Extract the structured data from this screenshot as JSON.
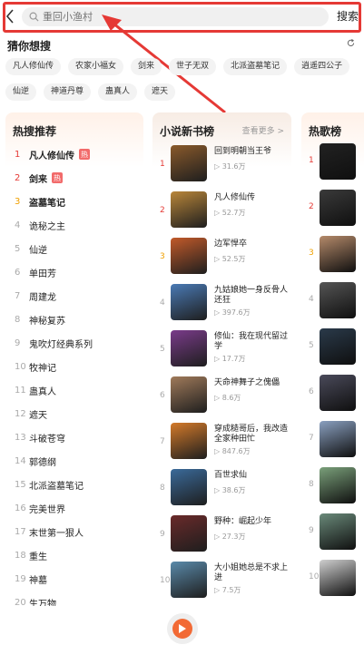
{
  "header": {
    "search_placeholder": "重回小渔村",
    "search_button": "搜索"
  },
  "guess": {
    "title": "猜你想搜",
    "chips": [
      [
        "凡人修仙传",
        "农家小福女",
        "剑来",
        "世子无双",
        "北派盗墓笔记",
        "逍遥四公子"
      ],
      [
        "仙逆",
        "神道丹尊",
        "蛊真人",
        "遮天"
      ]
    ]
  },
  "hot_search": {
    "title": "热搜推荐",
    "hot_badge": "热",
    "items": [
      {
        "rank": "1",
        "name": "凡人修仙传"
      },
      {
        "rank": "2",
        "name": "剑来"
      },
      {
        "rank": "3",
        "name": "盗墓笔记"
      },
      {
        "rank": "4",
        "name": "诡秘之主"
      },
      {
        "rank": "5",
        "name": "仙逆"
      },
      {
        "rank": "6",
        "name": "单田芳"
      },
      {
        "rank": "7",
        "name": "周建龙"
      },
      {
        "rank": "8",
        "name": "神秘复苏"
      },
      {
        "rank": "9",
        "name": "鬼吹灯经典系列"
      },
      {
        "rank": "10",
        "name": "牧神记"
      },
      {
        "rank": "11",
        "name": "蛊真人"
      },
      {
        "rank": "12",
        "name": "遮天"
      },
      {
        "rank": "13",
        "name": "斗破苍穹"
      },
      {
        "rank": "14",
        "name": "郭德纲"
      },
      {
        "rank": "15",
        "name": "北派盗墓笔记"
      },
      {
        "rank": "16",
        "name": "完美世界"
      },
      {
        "rank": "17",
        "name": "末世第一狠人"
      },
      {
        "rank": "18",
        "name": "重生"
      },
      {
        "rank": "19",
        "name": "神墓"
      },
      {
        "rank": "20",
        "name": "生万物"
      }
    ]
  },
  "new_books": {
    "title": "小说新书榜",
    "see_more": "查看更多 >",
    "items": [
      {
        "rank": "1",
        "title": "回到明朝当王爷",
        "count": "31.6万",
        "color": "#8a5a2b"
      },
      {
        "rank": "2",
        "title": "凡人修仙传",
        "count": "52.7万",
        "color": "#b9863a"
      },
      {
        "rank": "3",
        "title": "边军悍卒",
        "count": "52.5万",
        "color": "#c25a2a"
      },
      {
        "rank": "4",
        "title": "九姑娘她一身反骨人还狂",
        "count": "397.6万",
        "color": "#4a7ab5"
      },
      {
        "rank": "5",
        "title": "修仙：我在现代留过学",
        "count": "17.7万",
        "color": "#7a3b8a"
      },
      {
        "rank": "6",
        "title": "天命神舞子之傀儡",
        "count": "8.6万",
        "color": "#a07a5a"
      },
      {
        "rank": "7",
        "title": "穿成糙哥后，我改造全家种田忙",
        "count": "847.6万",
        "color": "#d47a2a"
      },
      {
        "rank": "8",
        "title": "百世求仙",
        "count": "38.6万",
        "color": "#3a6a9a"
      },
      {
        "rank": "9",
        "title": "野种：崛起少年",
        "count": "27.3万",
        "color": "#6a2a2a"
      },
      {
        "rank": "10",
        "title": "大小姐她总是不求上进",
        "count": "7.5万",
        "color": "#5a8aaa"
      }
    ]
  },
  "hot_songs": {
    "title": "热歌榜",
    "items": [
      {
        "rank": "1",
        "color": "#222222"
      },
      {
        "rank": "2",
        "color": "#3a3a3a"
      },
      {
        "rank": "3",
        "color": "#b58a6a"
      },
      {
        "rank": "4",
        "color": "#555555"
      },
      {
        "rank": "5",
        "color": "#2a3a4a"
      },
      {
        "rank": "6",
        "color": "#4a4a5a"
      },
      {
        "rank": "7",
        "color": "#8aa0c0"
      },
      {
        "rank": "8",
        "color": "#7aa07a"
      },
      {
        "rank": "9",
        "color": "#6a8a7a"
      },
      {
        "rank": "10",
        "color": "#cfcfcf"
      }
    ]
  },
  "colors": {
    "accent": "#e53935",
    "play": "#f26a35",
    "rank_third": "#f0a000"
  }
}
